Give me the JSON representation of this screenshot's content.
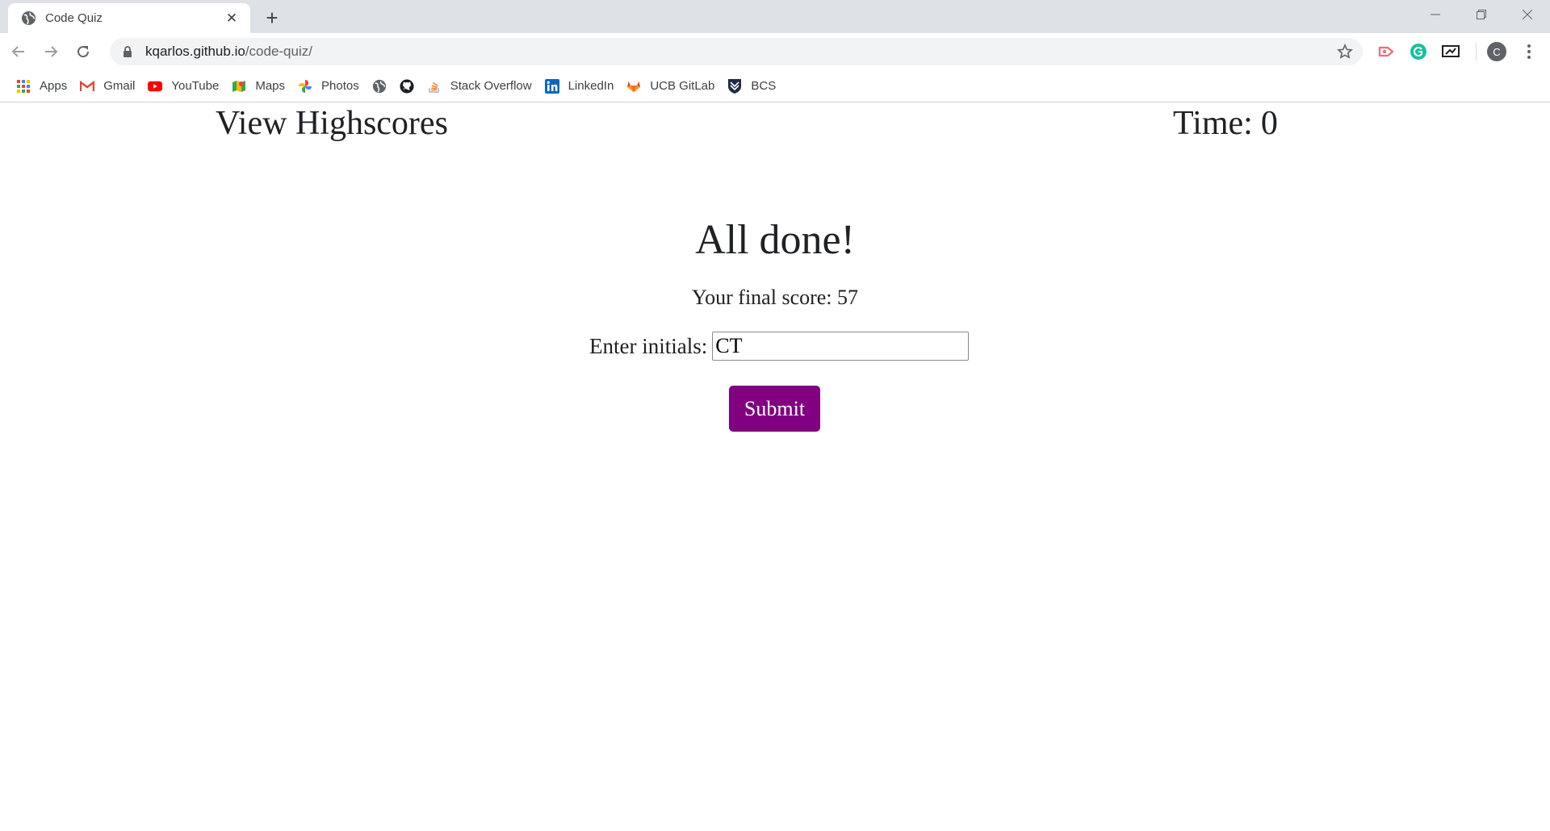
{
  "browser": {
    "tab_title": "Code Quiz",
    "url_domain": "kqarlos.github.io",
    "url_path": "/code-quiz/",
    "profile_initial": "C",
    "bookmarks": [
      {
        "label": "Apps",
        "icon": "apps-grid-icon"
      },
      {
        "label": "Gmail",
        "icon": "gmail-icon"
      },
      {
        "label": "YouTube",
        "icon": "youtube-icon"
      },
      {
        "label": "Maps",
        "icon": "maps-icon"
      },
      {
        "label": "Photos",
        "icon": "photos-icon"
      },
      {
        "label": "",
        "icon": "globe-icon"
      },
      {
        "label": "",
        "icon": "github-icon"
      },
      {
        "label": "Stack Overflow",
        "icon": "stackoverflow-icon"
      },
      {
        "label": "LinkedIn",
        "icon": "linkedin-icon"
      },
      {
        "label": "UCB GitLab",
        "icon": "gitlab-icon"
      },
      {
        "label": "BCS",
        "icon": "bcs-shield-icon"
      }
    ]
  },
  "quiz": {
    "view_highscores": "View Highscores",
    "timer_label": "Time:",
    "timer_value": "0",
    "title": "All done!",
    "final_score_label": "Your final score:",
    "final_score_value": "57",
    "initials_label": "Enter initials:",
    "initials_value": "CT",
    "submit_label": "Submit"
  },
  "colors": {
    "submit_bg": "#800080",
    "chrome_bg": "#dee1e6",
    "omnibox_bg": "#f1f3f4"
  }
}
